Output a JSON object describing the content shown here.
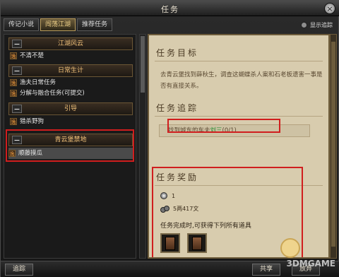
{
  "window": {
    "title": "任务",
    "close_icon": "close-icon"
  },
  "tabs": [
    {
      "label": "传记小说",
      "active": false
    },
    {
      "label": "闯荡江湖",
      "active": true
    },
    {
      "label": "推荐任务",
      "active": false
    }
  ],
  "auto_track": {
    "label": "显示追踪"
  },
  "quest_list": {
    "groups": [
      {
        "name": "江湖风云",
        "items": [
          "不清不楚"
        ]
      },
      {
        "name": "日常生计",
        "items": [
          "渔夫日常任务",
          "分解与融合任务(可提交)"
        ]
      },
      {
        "name": "引导",
        "items": [
          "猎杀野狗"
        ]
      },
      {
        "name": "青云堡禁地",
        "items": [
          "顺藤摸瓜"
        ]
      }
    ],
    "quest_marker": "逸",
    "selected_item": "顺藤摸瓜"
  },
  "details": {
    "objective_title": "任务目标",
    "objective_text": "去青云堡找到薛秋生，调查这蝴蝶杀人案和石老板遗害一事是否有直接关系。",
    "tracking_title": "任务追踪",
    "tracking_text_pre": "找到城东的车夫",
    "tracking_text_hl": "刘三",
    "tracking_text_post": "(0/1)",
    "reward_title": "任务奖励",
    "reward_exp": "1",
    "reward_money": "5两417文",
    "reward_note": "任务完成时,可获得下列所有道具"
  },
  "bottom": {
    "track_button": "追踪",
    "share_button": "共享",
    "abandon_button": "放弃"
  },
  "watermark": "3DMGAME",
  "colors": {
    "accent_gold": "#f2c27a",
    "highlight_red": "#d01e1e",
    "panel_parchment": "#d8ccae"
  }
}
